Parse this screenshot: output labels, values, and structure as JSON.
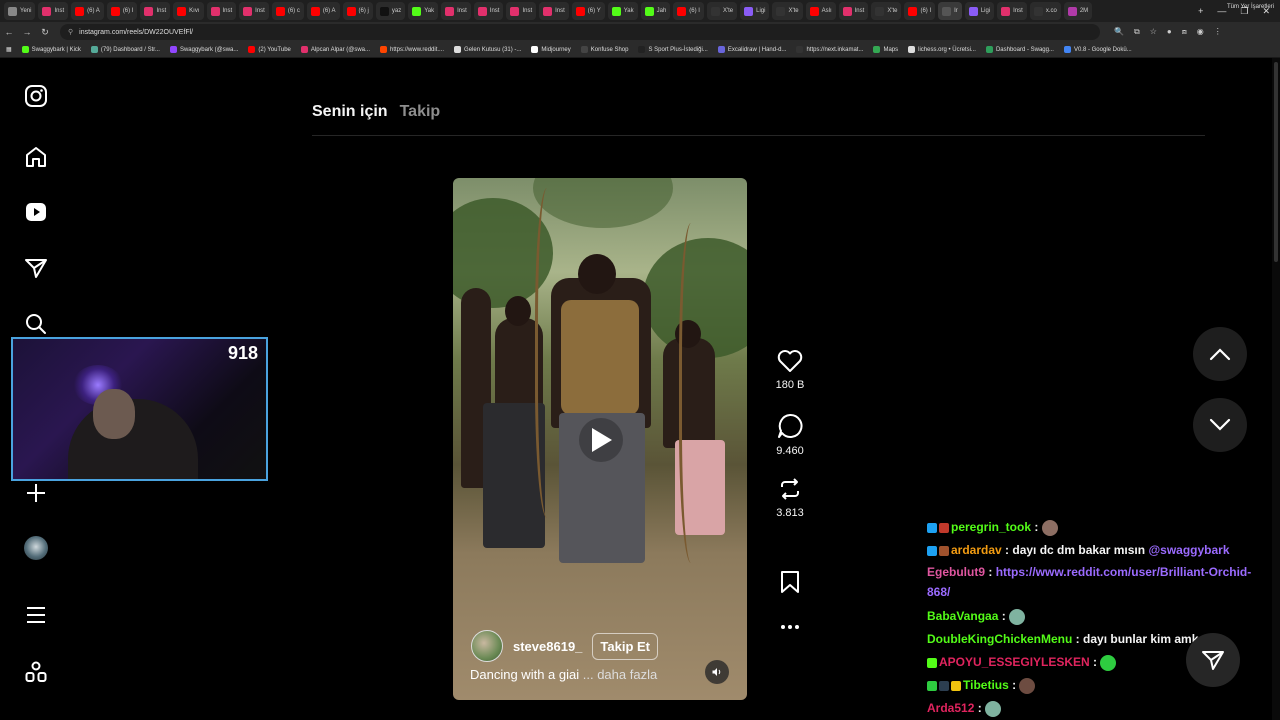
{
  "browser": {
    "tabs": [
      {
        "label": "Yeni",
        "color": "#888888"
      },
      {
        "label": "Inst",
        "color": "#e1306c"
      },
      {
        "label": "(6) A",
        "color": "#ff0000"
      },
      {
        "label": "(6) I",
        "color": "#ff0000"
      },
      {
        "label": "Inst",
        "color": "#e1306c"
      },
      {
        "label": "Kıvı",
        "color": "#ff0000"
      },
      {
        "label": "Inst",
        "color": "#e1306c"
      },
      {
        "label": "Inst",
        "color": "#e1306c"
      },
      {
        "label": "(6) c",
        "color": "#ff0000"
      },
      {
        "label": "(6) A",
        "color": "#ff0000"
      },
      {
        "label": "(6) j",
        "color": "#ff0000"
      },
      {
        "label": "yaz",
        "color": "#111111"
      },
      {
        "label": "Yak",
        "color": "#53fc18"
      },
      {
        "label": "Inst",
        "color": "#e1306c"
      },
      {
        "label": "Inst",
        "color": "#e1306c"
      },
      {
        "label": "Inst",
        "color": "#e1306c"
      },
      {
        "label": "Inst",
        "color": "#e1306c"
      },
      {
        "label": "(6) Y",
        "color": "#ff0000"
      },
      {
        "label": "Yak",
        "color": "#53fc18"
      },
      {
        "label": "Jah",
        "color": "#53fc18"
      },
      {
        "label": "(6) I",
        "color": "#ff0000"
      },
      {
        "label": "X'te",
        "color": "#333333"
      },
      {
        "label": "Ligi",
        "color": "#8a5cf6"
      },
      {
        "label": "X'te",
        "color": "#333333"
      },
      {
        "label": "Aslı",
        "color": "#ff0000"
      },
      {
        "label": "Inst",
        "color": "#e1306c"
      },
      {
        "label": "X'te",
        "color": "#333333"
      },
      {
        "label": "(6) I",
        "color": "#ff0000"
      },
      {
        "label": "Ir",
        "color": "#555555"
      },
      {
        "label": "Ligi",
        "color": "#8a5cf6"
      },
      {
        "label": "Inst",
        "color": "#e1306c"
      },
      {
        "label": "x.co",
        "color": "#333333"
      },
      {
        "label": "2M",
        "color": "#b03aa8"
      }
    ],
    "url": "instagram.com/reels/DW22OUVEfFl/",
    "bookmarks": [
      {
        "label": "Swaggybark | Kick",
        "color": "#53fc18"
      },
      {
        "label": "(79) Dashboard / Str...",
        "color": "#55aa99"
      },
      {
        "label": "Swaggybark (@swa...",
        "color": "#9146ff"
      },
      {
        "label": "(2) YouTube",
        "color": "#ff0000"
      },
      {
        "label": "Alpcan Alpar (@swa...",
        "color": "#e1306c"
      },
      {
        "label": "https://www.reddit....",
        "color": "#ff4500"
      },
      {
        "label": "Gelen Kutusu (31) -...",
        "color": "#dddddd"
      },
      {
        "label": "Midjourney",
        "color": "#ffffff"
      },
      {
        "label": "Konfuse Shop",
        "color": "#444444"
      },
      {
        "label": "S Sport Plus-İstediği...",
        "color": "#222222"
      },
      {
        "label": "Excalidraw | Hand-d...",
        "color": "#6965db"
      },
      {
        "label": "https://next.inkamat...",
        "color": "#333333"
      },
      {
        "label": "Maps",
        "color": "#34a853"
      },
      {
        "label": "lichess.org • Ücretsi...",
        "color": "#dddddd"
      },
      {
        "label": "Dashboard - Swagg...",
        "color": "#2e9e5b"
      },
      {
        "label": "V0.8 - Google Dokü...",
        "color": "#4285f4"
      }
    ],
    "bookmarks_all": "Tüm Yer İşaretleri"
  },
  "webcam": {
    "viewer_count": "918"
  },
  "feed": {
    "tab_for_you": "Senin için",
    "tab_following": "Takip"
  },
  "reel": {
    "username": "steve8619_",
    "follow_label": "Takip Et",
    "caption": "Dancing with a giai",
    "caption_more": "... daha fazla"
  },
  "actions": {
    "likes": "180 B",
    "comments": "9.460",
    "reposts": "3.813"
  },
  "chat": [
    {
      "user": "peregrin_took",
      "user_color": "#53fc18",
      "sep": " : ",
      "text": "",
      "badges": [
        "#1da1f2",
        "#c0392b"
      ],
      "emote_color": "#8d6e63"
    },
    {
      "user": "ardardav",
      "user_color": "#f39c12",
      "sep": " : ",
      "text": "dayı dc dm bakar mısın ",
      "mention": "@swaggybark",
      "badges": [
        "#1da1f2",
        "#a0522d"
      ]
    },
    {
      "user": "Egebulut9",
      "user_color": "#e056a0",
      "sep": " : ",
      "link": "https://www.reddit.com/user/Brilliant-Orchid-868/"
    },
    {
      "user": "BabaVangaa",
      "user_color": "#53fc18",
      "sep": " : ",
      "text": "",
      "emote_color": "#7fb3a0"
    },
    {
      "user": "DoubleKingChickenMenu",
      "user_color": "#53fc18",
      "sep": " : ",
      "text": "dayı bunlar kim amk"
    },
    {
      "user": "APOYU_ESSEGIYLESKEN",
      "user_color": "#e0245e",
      "sep": " : ",
      "text": "",
      "badges": [
        "#53fc18"
      ],
      "emote_color": "#2ecc40"
    },
    {
      "user": "Tibetius",
      "user_color": "#53fc18",
      "sep": " : ",
      "text": "",
      "badges": [
        "#2ecc40",
        "#2c3e50",
        "#f1c40f"
      ],
      "emote_color": "#6d4c41"
    },
    {
      "user": "Arda512",
      "user_color": "#e0245e",
      "sep": " : ",
      "text": "",
      "emote_color": "#7fb3a0"
    }
  ]
}
